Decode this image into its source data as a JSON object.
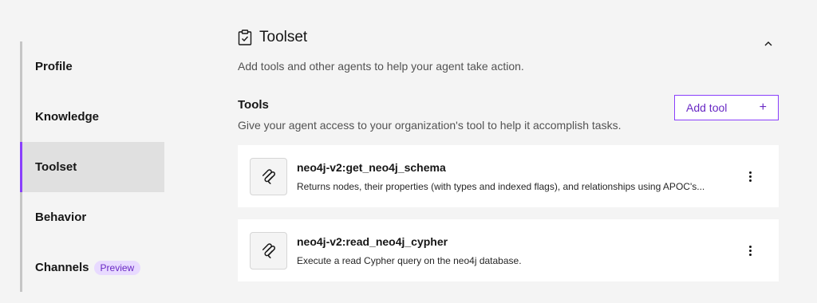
{
  "sidebar": {
    "items": [
      {
        "label": "Profile"
      },
      {
        "label": "Knowledge"
      },
      {
        "label": "Toolset"
      },
      {
        "label": "Behavior"
      },
      {
        "label": "Channels",
        "tag": "Preview"
      }
    ],
    "active": "Toolset"
  },
  "section": {
    "title": "Toolset",
    "description": "Add tools and other agents to help your agent take action.",
    "icon": "clipboard-check-icon"
  },
  "tools": {
    "title": "Tools",
    "description": "Give your agent access to your organization's tool to help it accomplish tasks.",
    "add_label": "Add tool",
    "add_icon": "+",
    "items": [
      {
        "name": "neo4j-v2:get_neo4j_schema",
        "description": "Returns nodes, their properties (with types and indexed flags), and relationships using APOC's..."
      },
      {
        "name": "neo4j-v2:read_neo4j_cypher",
        "description": "Execute a read Cypher query on the neo4j database."
      }
    ]
  },
  "colors": {
    "accent": "#8a3ffc",
    "active_bg": "#e0e0e0",
    "preview_bg": "#e8daff"
  }
}
